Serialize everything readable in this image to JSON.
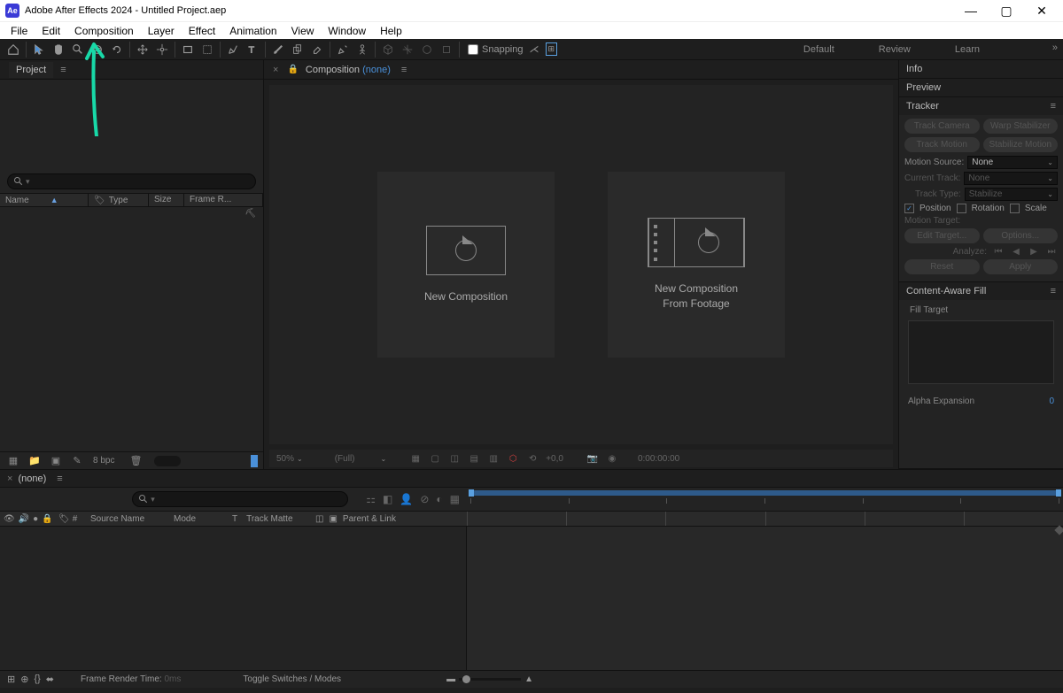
{
  "titlebar": {
    "app_prefix": "Ae",
    "title": "Adobe After Effects 2024 - Untitled Project.aep"
  },
  "menus": [
    "File",
    "Edit",
    "Composition",
    "Layer",
    "Effect",
    "Animation",
    "View",
    "Window",
    "Help"
  ],
  "toolbar": {
    "snapping_label": "Snapping",
    "workspaces": [
      "Default",
      "Review",
      "Learn"
    ]
  },
  "project_panel": {
    "tab": "Project",
    "columns": {
      "name": "Name",
      "type": "Type",
      "size": "Size",
      "framer": "Frame R..."
    },
    "bpc": "8 bpc"
  },
  "comp_viewer": {
    "tab_prefix": "Composition",
    "none": "(none)",
    "new_comp": "New Composition",
    "new_comp_footage_l1": "New Composition",
    "new_comp_footage_l2": "From Footage",
    "footer": {
      "zoom": "50%",
      "res": "(Full)",
      "exposure": "+0,0",
      "timecode": "0:00:00:00"
    }
  },
  "right": {
    "info": "Info",
    "preview": "Preview",
    "tracker": {
      "title": "Tracker",
      "track_camera": "Track Camera",
      "warp_stabilizer": "Warp Stabilizer",
      "track_motion": "Track Motion",
      "stabilize_motion": "Stabilize Motion",
      "motion_source": "Motion Source:",
      "motion_source_value": "None",
      "current_track": "Current Track:",
      "current_track_value": "None",
      "track_type": "Track Type:",
      "track_type_value": "Stabilize",
      "position": "Position",
      "rotation": "Rotation",
      "scale": "Scale",
      "motion_target": "Motion Target:",
      "edit_target": "Edit Target...",
      "options": "Options...",
      "analyze": "Analyze:",
      "reset": "Reset",
      "apply": "Apply"
    },
    "caf": {
      "title": "Content-Aware Fill",
      "fill_target": "Fill Target",
      "alpha_expansion": "Alpha Expansion",
      "alpha_value": "0"
    }
  },
  "timeline": {
    "tab": "(none)",
    "cols": {
      "source": "Source Name",
      "mode": "Mode",
      "t": "T",
      "track_matte": "Track Matte",
      "parent": "Parent & Link",
      "num": "#"
    }
  },
  "statusbar": {
    "frame_render": "Frame Render Time:",
    "frame_render_value": "0ms",
    "toggle_switches": "Toggle Switches / Modes"
  }
}
